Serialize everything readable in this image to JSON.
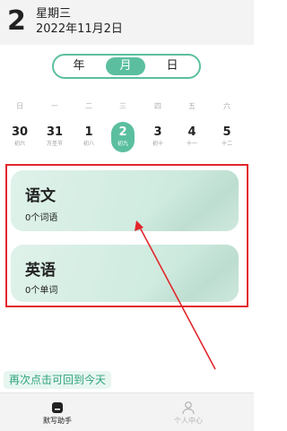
{
  "header": {
    "day": "2",
    "weekday": "星期三",
    "date": "2022年11月2日"
  },
  "view_switch": {
    "options": [
      "年",
      "月",
      "日"
    ],
    "selected": "月"
  },
  "week_labels": [
    "日",
    "一",
    "二",
    "三",
    "四",
    "五",
    "六"
  ],
  "days": [
    {
      "num": "30",
      "lunar": "初六"
    },
    {
      "num": "31",
      "lunar": "万圣节"
    },
    {
      "num": "1",
      "lunar": "初八"
    },
    {
      "num": "2",
      "lunar": "初九",
      "selected": true
    },
    {
      "num": "3",
      "lunar": "初十"
    },
    {
      "num": "4",
      "lunar": "十一"
    },
    {
      "num": "5",
      "lunar": "十二"
    }
  ],
  "cards": [
    {
      "title": "语文",
      "subtitle": "0个词语"
    },
    {
      "title": "英语",
      "subtitle": "0个单词"
    }
  ],
  "today_hint": "再次点击可回到今天",
  "tabbar": {
    "items": [
      {
        "label": "默写助手",
        "icon": "dictation-icon",
        "active": true
      },
      {
        "label": "个人中心",
        "icon": "person-icon",
        "active": false
      }
    ]
  },
  "colors": {
    "accent": "#5bbf9f",
    "annotation": "#e2262b"
  }
}
